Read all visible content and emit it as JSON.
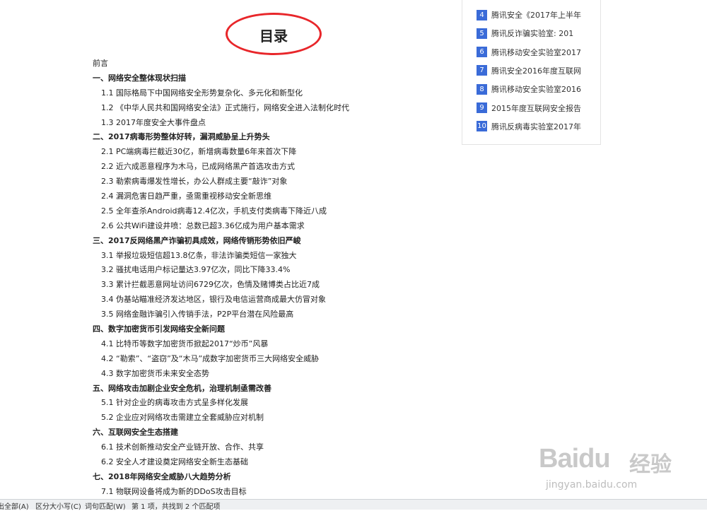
{
  "heading": "目录",
  "toc": [
    {
      "kind": "intro",
      "text": "前言"
    },
    {
      "kind": "section",
      "text": "一、网络安全整体现状扫描"
    },
    {
      "kind": "sub",
      "text": "1.1 国际格局下中国网络安全形势复杂化、多元化和新型化"
    },
    {
      "kind": "sub",
      "text": "1.2 《中华人民共和国网络安全法》正式施行，网络安全进入法制化时代"
    },
    {
      "kind": "sub",
      "text": "1.3 2017年度安全大事件盘点"
    },
    {
      "kind": "section",
      "text": "二、2017病毒形势整体好转，漏洞威胁呈上升势头"
    },
    {
      "kind": "sub",
      "text": "2.1 PC端病毒拦截近30亿，新增病毒数量6年来首次下降"
    },
    {
      "kind": "sub",
      "text": "2.2 近六成恶意程序为木马，已成网络黑产首选攻击方式"
    },
    {
      "kind": "sub",
      "text": "2.3 勒索病毒爆发性增长，办公人群成主要“敲诈”对象"
    },
    {
      "kind": "sub",
      "text": "2.4 漏洞危害日趋严重，亟需重视移动安全新思维"
    },
    {
      "kind": "sub",
      "text": "2.5 全年查杀Android病毒12.4亿次，手机支付类病毒下降近八成"
    },
    {
      "kind": "sub",
      "text": "2.6 公共WiFi建设井喷：总数已超3.36亿成为用户基本需求"
    },
    {
      "kind": "section",
      "text": "三、2017反网络黑产诈骗初具成效，网络传销形势依旧严峻"
    },
    {
      "kind": "sub",
      "text": "3.1 举报垃圾短信超13.8亿条，非法诈骗类短信一家独大"
    },
    {
      "kind": "sub",
      "text": "3.2 骚扰电话用户标记量达3.97亿次，同比下降33.4%"
    },
    {
      "kind": "sub",
      "text": "3.3 累计拦截恶意网址访问6729亿次，色情及赌博类占比近7成"
    },
    {
      "kind": "sub",
      "text": "3.4 伪基站瞄准经济发达地区，银行及电信运营商成最大仿冒对象"
    },
    {
      "kind": "sub",
      "text": "3.5 网络金融诈骗引入传销手法，P2P平台潜在风险最高"
    },
    {
      "kind": "section",
      "text": "四、数字加密货币引发网络安全新问题"
    },
    {
      "kind": "sub",
      "text": "4.1 比特币等数字加密货币掀起2017“炒币”风暴"
    },
    {
      "kind": "sub",
      "text": "4.2 “勒索”、“盗窃”及“木马”成数字加密货币三大网络安全威胁"
    },
    {
      "kind": "sub",
      "text": "4.3 数字加密货币未来安全态势"
    },
    {
      "kind": "section",
      "text": "五、网络攻击加剧企业安全危机，治理机制亟需改善"
    },
    {
      "kind": "sub",
      "text": "5.1 针对企业的病毒攻击方式呈多样化发展"
    },
    {
      "kind": "sub",
      "text": "5.2 企业应对网络攻击需建立全套威胁应对机制"
    },
    {
      "kind": "section",
      "text": "六、互联网安全生态搭建"
    },
    {
      "kind": "sub",
      "text": "6.1 技术创新推动安全产业链开放、合作、共享"
    },
    {
      "kind": "sub",
      "text": "6.2 安全人才建设奠定网络安全新生态基础"
    },
    {
      "kind": "section",
      "text": "七、2018年网络安全威胁八大趋势分析"
    },
    {
      "kind": "sub",
      "text": "7.1 物联网设备将成为新的DDoS攻击目标"
    }
  ],
  "related": [
    {
      "num": "4",
      "text": "腾讯安全《2017年上半年"
    },
    {
      "num": "5",
      "text": "腾讯反诈骗实验室: 201"
    },
    {
      "num": "6",
      "text": "腾讯移动安全实验室2017"
    },
    {
      "num": "7",
      "text": "腾讯安全2016年度互联网"
    },
    {
      "num": "8",
      "text": "腾讯移动安全实验室2016"
    },
    {
      "num": "9",
      "text": "2015年度互联网安全报告"
    },
    {
      "num": "10",
      "text": "腾讯反病毒实验室2017年"
    }
  ],
  "watermark": {
    "logo": "Baidu",
    "cn": "经验",
    "url": "jingyan.baidu.com"
  },
  "find_bar": {
    "match_all": "突出全部(A)",
    "match_case": "区分大小写(C)",
    "whole_word": "词句匹配(W)",
    "status": "第 1 项，共找到 2 个匹配项"
  },
  "colors": {
    "accent": "#3a6bd8",
    "highlight_ring": "#e8262a"
  }
}
